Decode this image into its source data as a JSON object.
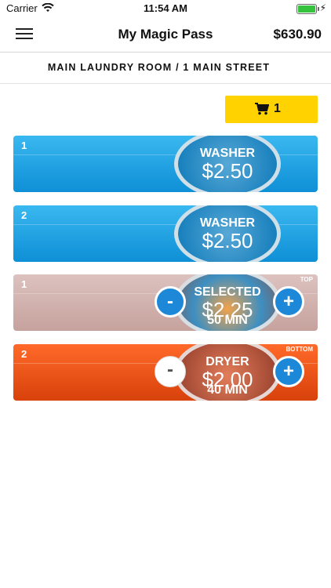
{
  "status_bar": {
    "carrier": "Carrier",
    "time": "11:54 AM"
  },
  "nav": {
    "title": "My Magic Pass",
    "balance": "$630.90"
  },
  "location": "MAIN LAUNDRY ROOM / 1 MAIN STREET",
  "cart": {
    "count": "1",
    "icon": "cart-icon"
  },
  "machines": [
    {
      "number": "1",
      "title": "WASHER",
      "price": "$2.50"
    },
    {
      "number": "2",
      "title": "WASHER",
      "price": "$2.50"
    },
    {
      "number": "1",
      "title": "SELECTED",
      "price": "$2.25",
      "duration": "50 MIN",
      "position": "TOP",
      "minus": "-",
      "plus": "+"
    },
    {
      "number": "2",
      "title": "DRYER",
      "price": "$2.00",
      "duration": "40 MIN",
      "position": "BOTTOM",
      "minus": "-",
      "plus": "+"
    }
  ],
  "colors": {
    "washer": "#1aa3e8",
    "selected": "#d3b6b2",
    "dryer": "#f0561a",
    "cart": "#ffd200",
    "button_blue": "#1e88d8"
  }
}
